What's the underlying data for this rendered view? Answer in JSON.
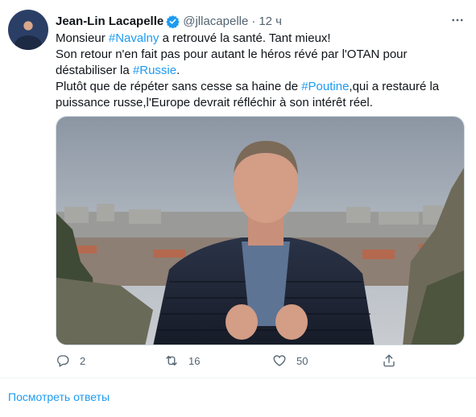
{
  "tweet": {
    "author_name": "Jean-Lin Lacapelle",
    "handle": "@jllacapelle",
    "separator": "·",
    "time": "12 ч",
    "body": {
      "line1_pre": "Monsieur ",
      "line1_tag": "#Navalny",
      "line1_post": " a retrouvé la santé. Tant mieux!",
      "line2_pre": "Son retour n'en fait pas pour autant le héros révé par l'OTAN pour déstabiliser la ",
      "line2_tag": "#Russie",
      "line2_post": ".",
      "line3_pre": "Plutôt que de répéter sans cesse sa haine de ",
      "line3_tag": "#Poutine",
      "line3_post": ",qui a restauré la puissance russe,l'Europe devrait réfléchir à son intérêt réel."
    },
    "actions": {
      "reply_count": "2",
      "retweet_count": "16",
      "like_count": "50"
    }
  },
  "footer": {
    "show_replies": "Посмотреть ответы"
  },
  "colors": {
    "accent": "#1d9bf0",
    "secondary_text": "#536471"
  },
  "icons": [
    "verified-badge-icon",
    "more-icon",
    "reply-icon",
    "retweet-icon",
    "like-icon",
    "share-icon"
  ]
}
